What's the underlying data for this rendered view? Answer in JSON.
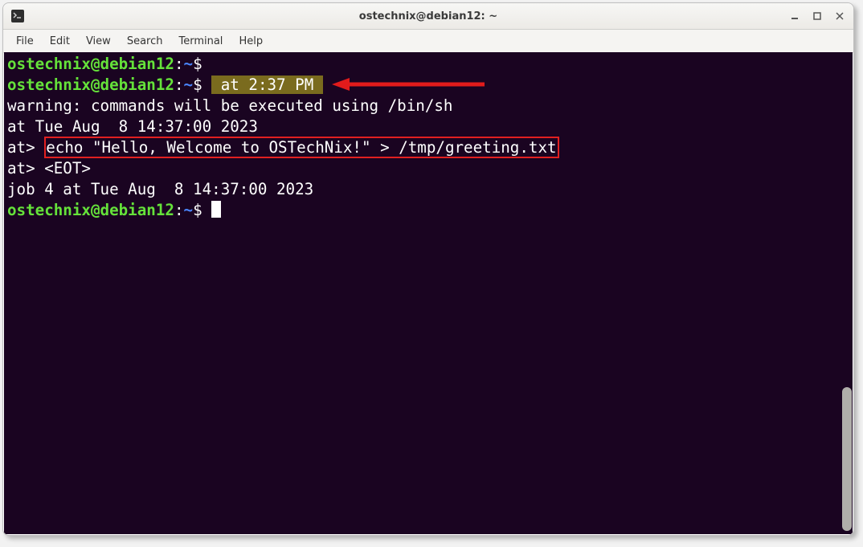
{
  "window": {
    "title": "ostechnix@debian12: ~"
  },
  "menubar": [
    "File",
    "Edit",
    "View",
    "Search",
    "Terminal",
    "Help"
  ],
  "prompt": {
    "user_host": "ostechnix@debian12",
    "colon": ":",
    "path": "~",
    "sigil": "$"
  },
  "lines": {
    "cmd1_highlight": " at 2:37 PM ",
    "warn": "warning: commands will be executed using /bin/sh",
    "sched": "at Tue Aug  8 14:37:00 2023",
    "atp1_prefix": "at> ",
    "atp1_cmd": "echo \"Hello, Welcome to OSTechNix!\" > /tmp/greeting.txt",
    "atp2": "at> <EOT>",
    "job": "job 4 at Tue Aug  8 14:37:00 2023"
  }
}
